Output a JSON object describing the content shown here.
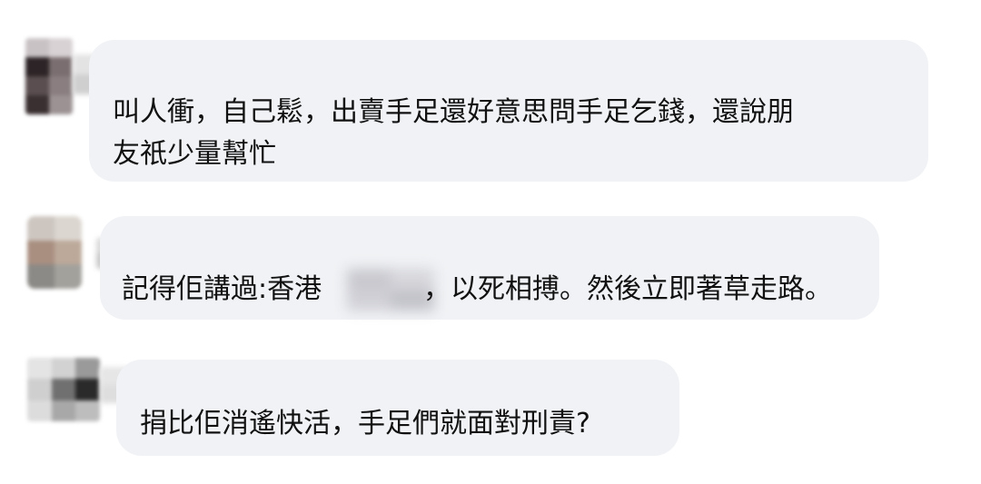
{
  "comments": [
    {
      "text_lines": [
        "叫人衝，自己鬆，出賣手足還好意思問手足乞錢，還說朋",
        "友祇少量幫忙"
      ]
    },
    {
      "text_before": "記得佢講過:香港",
      "text_after": "，以死相搏。然後立即著草走路。"
    },
    {
      "text": "捐比佢消遙快活，手足們就面對刑責?"
    }
  ],
  "colors": {
    "bubble_background": "#f0f2f5",
    "text": "#111111",
    "page_background": "#ffffff"
  }
}
